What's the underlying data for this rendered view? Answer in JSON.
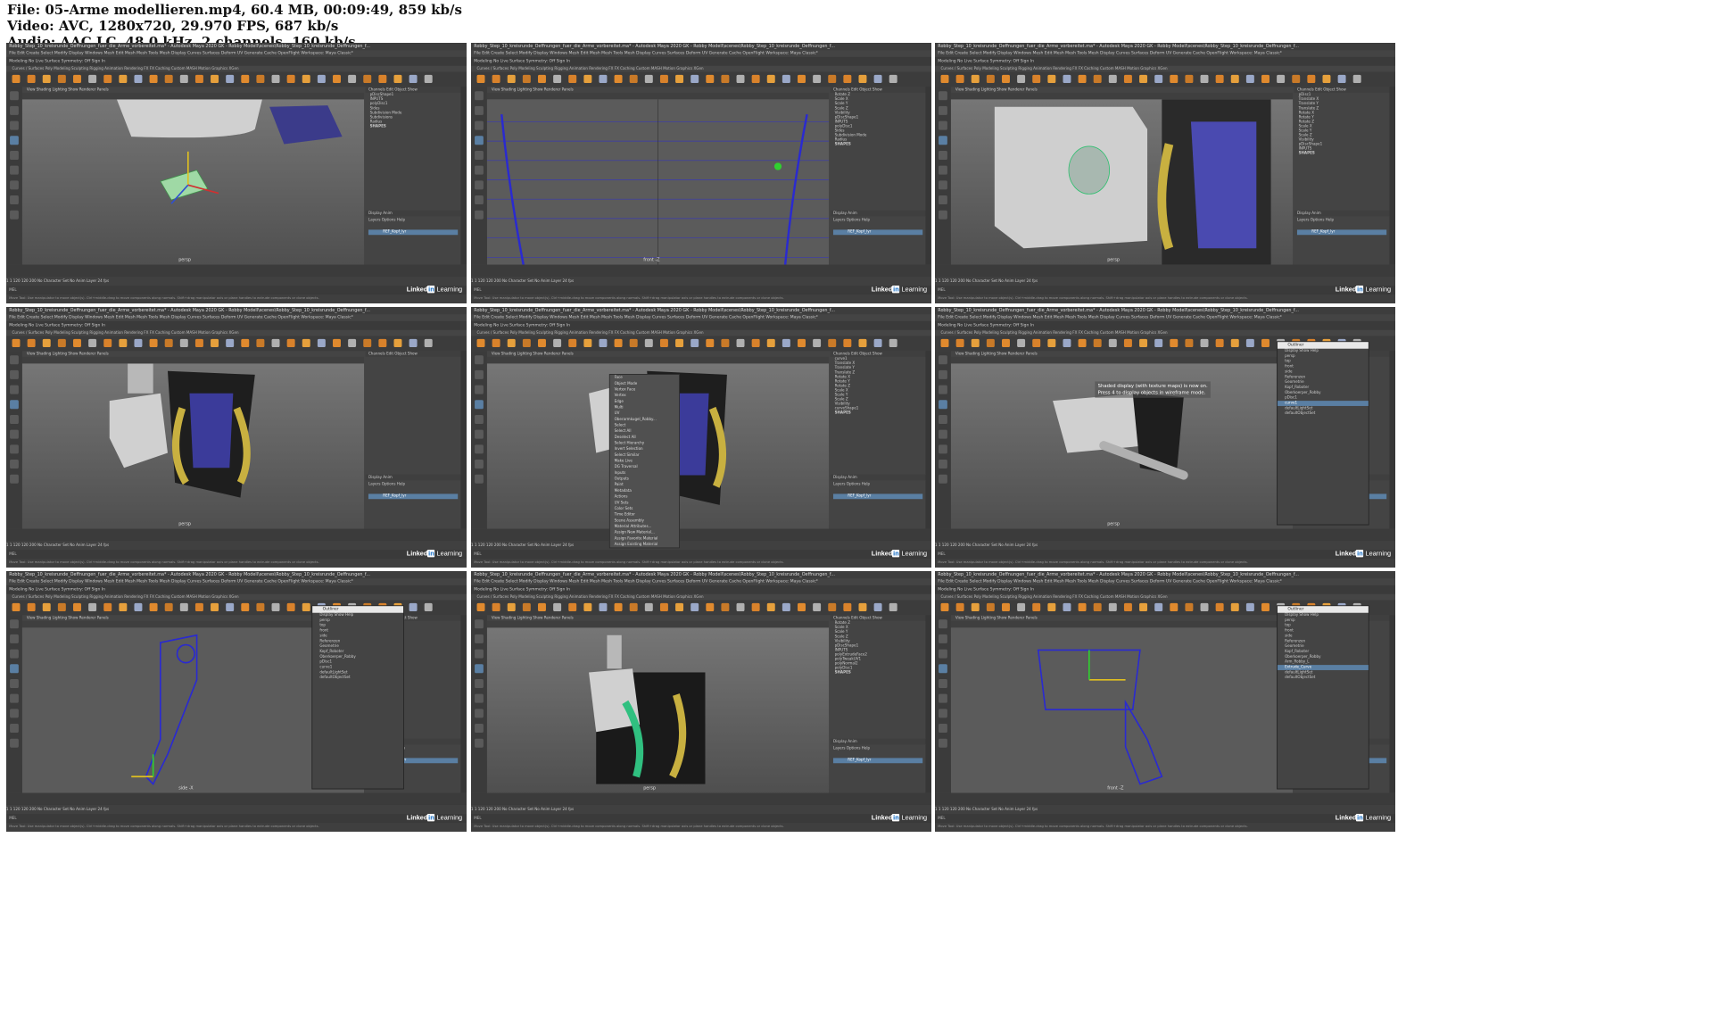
{
  "file_info": {
    "file_line": "File: 05-Arme modellieren.mp4, 60.4 MB, 00:09:49, 859 kb/s",
    "video_line": "Video: AVC, 1280x720, 29.970 FPS, 687 kb/s",
    "audio_line": "Audio: AAC LC, 48.0 kHz, 2 channels, 160 kb/s"
  },
  "common": {
    "window_title": "Robby_Step_10_kreisrunde_Oeffnungen_fuer_die_Arme_vorbereitet.ma* - Autodesk Maya 2020 GK - Robby Modell\\scenes\\Robby_Step_10_kreisrunde_Oeffnungen_f...",
    "menu": "File  Edit  Create  Select  Modify  Display  Windows  Mesh  Edit Mesh  Mesh Tools  Mesh Display  Curves  Surfaces  Deform  UV  Generate  Cache  OpenFlight    Workspace:  Maya Classic*",
    "status_line": "Modeling      No Live Surface      Symmetry: Off      Sign In",
    "shelf_tabs": "Curves / Surfaces   Poly Modeling   Sculpting   Rigging   Animation   Rendering   FX   FX Caching   Custom   MASH   Motion Graphics   XGen",
    "panel_menu": "View   Shading   Lighting   Show   Renderer   Panels",
    "channel_tabs": "Channels   Edit   Object   Show",
    "range_text": "1        1        120        120        200        No Character Set        No Anim Layer        24 fps",
    "cmd_label": "MEL",
    "layer_tabs": "Display   Anim",
    "layer_menu": "Layers   Options   Help",
    "layer_name": "REF_Kopf_lyr",
    "watermark_word": "Linked",
    "watermark_box": "in",
    "watermark_tail": " Learning",
    "help_line": "Move Tool: Use manipulator to move object(s). Ctrl+middle-drag to move components along normals. Shift+drag manipulator axis or plane handles to extrude components or clone objects."
  },
  "thumbs": [
    {
      "camera": "persp",
      "channels": [
        "pDiscShape1",
        "INPUTS",
        "polyDisc1",
        "Sides",
        "Subdivision Mode",
        "Subdivisions",
        "Radius"
      ],
      "shapes_label": "SHAPES"
    },
    {
      "camera": "front -Z",
      "channels": [
        "Rotate Z",
        "Scale X",
        "Scale Y",
        "Scale Z",
        "Visibility",
        "pDiscShape1",
        "INPUTS",
        "polyDisc1",
        "Sides",
        "Subdivision Mode",
        "Radius"
      ],
      "shapes_label": "SHAPES"
    },
    {
      "camera": "persp",
      "channels": [
        "pDisc1",
        "Translate X",
        "Translate Y",
        "Translate Z",
        "Rotate X",
        "Rotate Y",
        "Rotate Z",
        "Scale X",
        "Scale Y",
        "Scale Z",
        "Visibility",
        "pDiscShape1",
        "INPUTS"
      ],
      "shapes_label": "SHAPES"
    },
    {
      "camera": "persp",
      "channels": [],
      "shapes_label": ""
    },
    {
      "camera": "persp",
      "channels": [
        "curve1",
        "Translate X",
        "Translate Y",
        "Translate Z",
        "Rotate X",
        "Rotate Y",
        "Rotate Z",
        "Scale X",
        "Scale Y",
        "Scale Z",
        "Visibility",
        "curveShape1"
      ],
      "shapes_label": "SHAPES",
      "context_menu": [
        "Face",
        "Object Mode",
        "Vertex Face",
        "Vertex",
        "Edge",
        "Multi",
        "UV",
        "Oberarmkugel_Robby...",
        "Select",
        "Select All",
        "Deselect All",
        "Select Hierarchy",
        "Invert Selection",
        "Select Similar",
        "Make Live",
        "DG Traversal",
        "Inputs",
        "Outputs",
        "Paint",
        "Metadata",
        "Actions",
        "UV Sets",
        "Color Sets",
        "Time Editor",
        "Scene Assembly",
        "Material Attributes...",
        "Assign New Material...",
        "Assign Favorite Material",
        "Assign Existing Material"
      ]
    },
    {
      "camera": "persp",
      "channels": [
        "Translate X",
        "Translate Y",
        "Translate Z",
        "Rotate X",
        "Rotate Y",
        "Rotate Z",
        "Scale X",
        "Scale Y",
        "Scale Z",
        "Visibility"
      ],
      "shapes_label": "",
      "hud": [
        "Shaded display (with texture maps) is now on.",
        "Press 4 to display objects in wireframe mode."
      ],
      "outliner": {
        "title": "Outliner",
        "menu": "Display   Show   Help",
        "rows": [
          "persp",
          "top",
          "front",
          "side",
          "Referenzen",
          "Geometrie",
          "Kopf_Roboter",
          "Oberkoerper_Robby",
          "pDisc1",
          "curve1",
          "defaultLightSet",
          "defaultObjectSet"
        ],
        "selected": 9
      }
    },
    {
      "camera": "side -X",
      "channels": [],
      "shapes_label": "",
      "outliner": {
        "title": "Outliner",
        "menu": "Display   Show   Help",
        "rows": [
          "persp",
          "top",
          "front",
          "side",
          "Referenzen",
          "Geometrie",
          "Kopf_Roboter",
          "Oberkoerper_Robby",
          "pDisc1",
          "curve1",
          "defaultLightSet",
          "defaultObjectSet"
        ],
        "selected": -1
      }
    },
    {
      "camera": "persp",
      "channels": [
        "Rotate Z",
        "Scale X",
        "Scale Y",
        "Scale Z",
        "Visibility",
        "pDiscShape1",
        "INPUTS",
        "polyExtrudeFace2",
        "polyTweakUV1",
        "polyNormal2",
        "polyDisc1"
      ],
      "shapes_label": "SHAPES"
    },
    {
      "camera": "front -Z",
      "channels": [
        "Translate X",
        "Translate Y",
        "Translate Z",
        "Rotate X",
        "Rotate Y",
        "Rotate Z",
        "Scale X",
        "Scale Y",
        "Scale Z",
        "Visibility",
        "curveShape"
      ],
      "shapes_label": "",
      "outliner": {
        "title": "Outliner",
        "menu": "Display   Show   Help",
        "rows": [
          "persp",
          "top",
          "front",
          "side",
          "Referenzen",
          "Geometrie",
          "Kopf_Roboter",
          "Oberkoerper_Robby",
          "Arm_Robby_L",
          "Extrude_Curve",
          "defaultLightSet",
          "defaultObjectSet"
        ],
        "selected": 9
      }
    }
  ]
}
